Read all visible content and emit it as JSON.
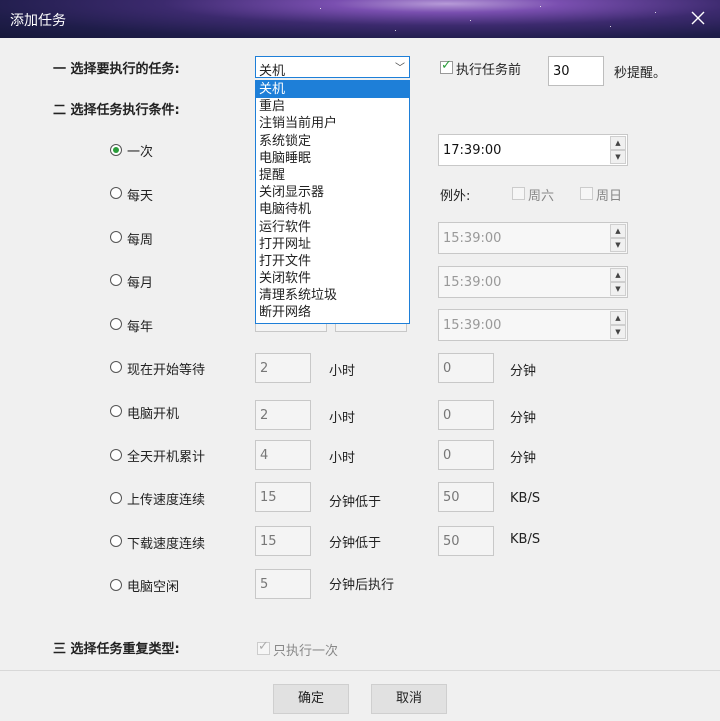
{
  "window": {
    "title": "添加任务"
  },
  "section1": {
    "label": "一 选择要执行的任务:"
  },
  "task_select": {
    "selected": "关机",
    "options": [
      "关机",
      "重启",
      "注销当前用户",
      "系统锁定",
      "电脑睡眠",
      "提醒",
      "关闭显示器",
      "电脑待机",
      "运行软件",
      "打开网址",
      "打开文件",
      "关闭软件",
      "清理系统垃圾",
      "断开网络"
    ]
  },
  "pre_remind": {
    "checkbox_label": "执行任务前",
    "seconds": "30",
    "suffix": "秒提醒。"
  },
  "section2": {
    "label": "二 选择任务执行条件:"
  },
  "conditions": {
    "once": {
      "label": "一次",
      "time": "17:39:00"
    },
    "daily": {
      "label": "每天",
      "exception_label": "例外:",
      "sat_label": "周六",
      "sun_label": "周日"
    },
    "weekly": {
      "label": "每周",
      "time": "15:39:00"
    },
    "monthly": {
      "label": "每月",
      "time": "15:39:00"
    },
    "yearly": {
      "label": "每年",
      "time": "15:39:00"
    },
    "wait_from_now": {
      "label": "现在开始等待",
      "hours": "2",
      "hours_unit": "小时",
      "minutes": "0",
      "minutes_unit": "分钟"
    },
    "computer_on": {
      "label": "电脑开机",
      "hours": "2",
      "hours_unit": "小时",
      "minutes": "0",
      "minutes_unit": "分钟"
    },
    "day_uptime": {
      "label": "全天开机累计",
      "hours": "4",
      "hours_unit": "小时",
      "minutes": "0",
      "minutes_unit": "分钟"
    },
    "upload_speed": {
      "label": "上传速度连续",
      "minutes": "15",
      "minutes_unit": "分钟低于",
      "speed": "50",
      "speed_unit": "KB/S"
    },
    "download_speed": {
      "label": "下载速度连续",
      "minutes": "15",
      "minutes_unit": "分钟低于",
      "speed": "50",
      "speed_unit": "KB/S"
    },
    "idle": {
      "label": "电脑空闲",
      "minutes": "5",
      "minutes_unit": "分钟后执行"
    }
  },
  "section3": {
    "label": "三 选择任务重复类型:",
    "once_only_label": "只执行一次"
  },
  "footer": {
    "ok_label": "确定",
    "cancel_label": "取消"
  },
  "colors": {
    "accent": "#1e7fd8",
    "radio_on": "#2a9d3a",
    "check": "#2a9d3a"
  }
}
